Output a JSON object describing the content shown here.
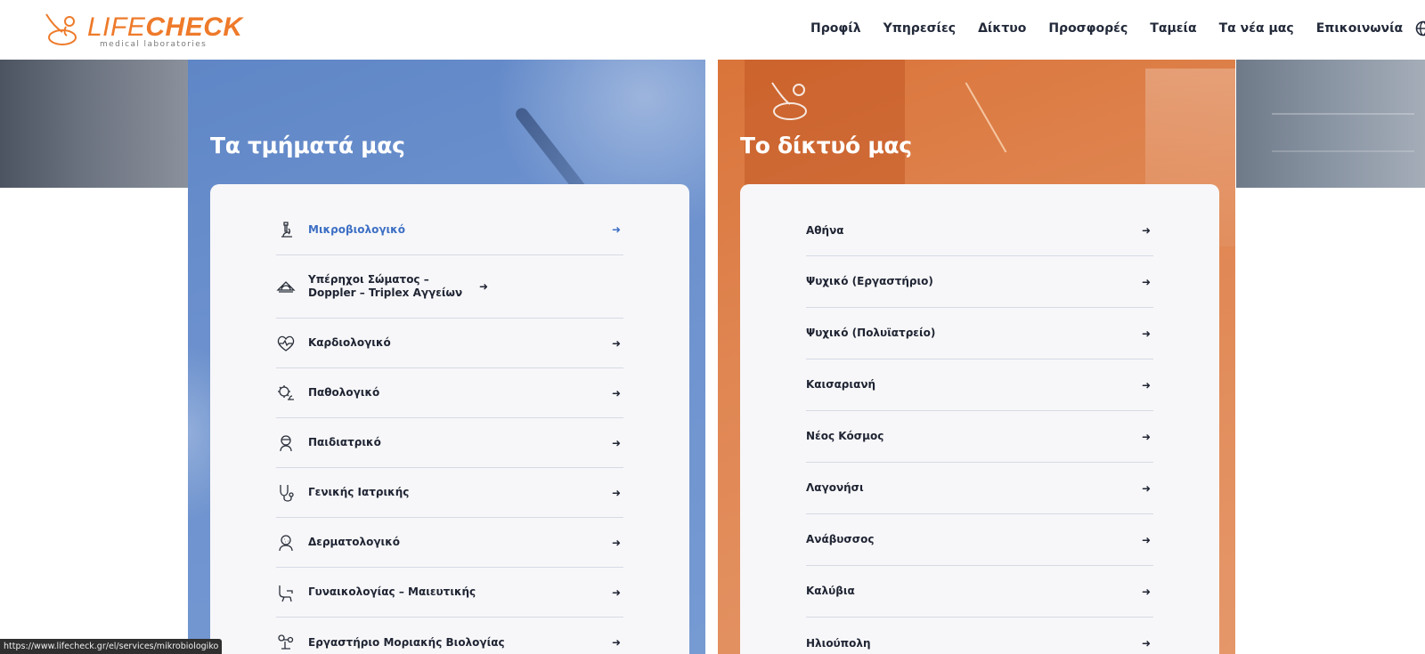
{
  "header": {
    "logo": {
      "brand_light": "LIFE",
      "brand_bold": "CHECK",
      "tagline": "medical laboratories"
    },
    "nav": [
      "Προφίλ",
      "Υπηρεσίες",
      "Δίκτυο",
      "Προσφορές",
      "Ταμεία",
      "Τα νέα μας",
      "Επικοινωνία"
    ],
    "language_icon": "globe-icon"
  },
  "departments": {
    "title": "Τα τμήματά μας",
    "items": [
      {
        "label": "Μικροβιολογικό",
        "icon": "microscope-icon",
        "active": true
      },
      {
        "label": "Υπέρηχοι Σώματος – Doppler – Triplex Αγγείων",
        "icon": "ultrasound-icon",
        "active": false
      },
      {
        "label": "Καρδιολογικό",
        "icon": "heart-pulse-icon",
        "active": false
      },
      {
        "label": "Παθολογικό",
        "icon": "virus-icon",
        "active": false
      },
      {
        "label": "Παιδιατρικό",
        "icon": "child-icon",
        "active": false
      },
      {
        "label": "Γενικής Ιατρικής",
        "icon": "stethoscope-icon",
        "active": false
      },
      {
        "label": "Δερματολογικό",
        "icon": "skin-icon",
        "active": false
      },
      {
        "label": "Γυναικολογίας – Μαιευτικής",
        "icon": "gyno-chair-icon",
        "active": false
      },
      {
        "label": "Εργαστήριο Μοριακής Βιολογίας",
        "icon": "molecule-icon",
        "active": false
      }
    ],
    "arrow": "➜"
  },
  "network": {
    "title": "Το δίκτυό μας",
    "items": [
      "Αθήνα",
      "Ψυχικό (Εργαστήριο)",
      "Ψυχικό (Πολυϊατρείο)",
      "Καισαριανή",
      "Νέος Κόσμος",
      "Λαγονήσι",
      "Ανάβυσσος",
      "Καλύβια",
      "Ηλιούπολη"
    ],
    "arrow": "➜"
  },
  "status_bar": {
    "url": "https://www.lifecheck.gr/el/services/mikrobiologiko"
  },
  "colors": {
    "brand_orange": "#ee7a2a",
    "blue_panel": "#6b90cd",
    "orange_panel": "#e08652",
    "active_link": "#3d6fc4"
  }
}
